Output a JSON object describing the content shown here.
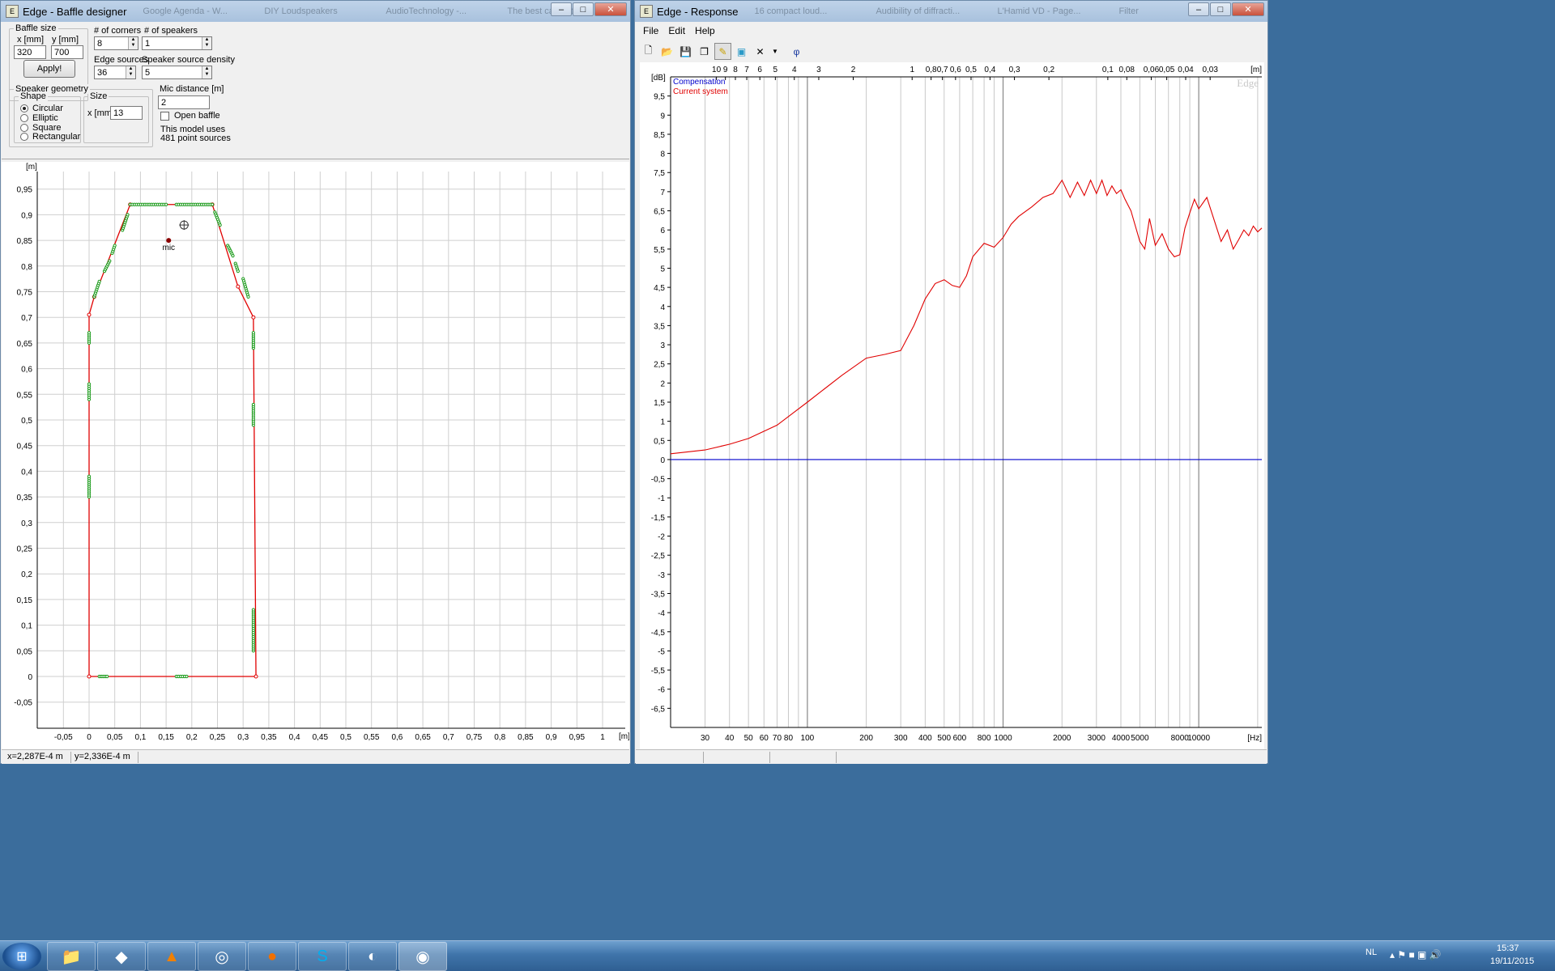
{
  "left_window": {
    "title": "Edge - Baffle designer",
    "baffle_size": {
      "group_label": "Baffle size",
      "x_label": "x [mm]",
      "y_label": "y [mm]",
      "x_value": "320",
      "y_value": "700",
      "apply_label": "Apply!"
    },
    "corners": {
      "label": "# of corners",
      "value": "8"
    },
    "speakers": {
      "label": "# of speakers",
      "value": "1"
    },
    "edge_sources": {
      "label": "Edge sources",
      "value": "36"
    },
    "speaker_density": {
      "label": "Speaker source density",
      "value": "5"
    },
    "speaker_geometry": {
      "group_label": "Speaker geometry",
      "shape_label": "Shape",
      "shapes": [
        "Circular",
        "Elliptic",
        "Square",
        "Rectangular"
      ],
      "selected_shape": "Circular",
      "size_label": "Size",
      "size_x_label": "x [mm]",
      "size_x_value": "13"
    },
    "mic_distance": {
      "label": "Mic distance [m]",
      "value": "2"
    },
    "open_baffle_label": "Open baffle",
    "model_info_line1": "This model uses",
    "model_info_line2": "481 point sources",
    "plot": {
      "unit_label": "[m]",
      "x_ticks": [
        "-0,05",
        "0",
        "0,05",
        "0,1",
        "0,15",
        "0,2",
        "0,25",
        "0,3",
        "0,35",
        "0,4",
        "0,45",
        "0,5",
        "0,55",
        "0,6",
        "0,65",
        "0,7",
        "0,75",
        "0,8",
        "0,85",
        "0,9",
        "0,95",
        "1"
      ],
      "y_ticks": [
        "0,95",
        "0,9",
        "0,85",
        "0,8",
        "0,75",
        "0,7",
        "0,65",
        "0,6",
        "0,55",
        "0,5",
        "0,45",
        "0,4",
        "0,35",
        "0,3",
        "0,25",
        "0,2",
        "0,15",
        "0,1",
        "0,05",
        "0",
        "-0,05"
      ],
      "mic_label": "mic",
      "colors": {
        "outline": "#e00000",
        "sources": "#1a9a1a",
        "mic": "#8b0000"
      }
    },
    "status_x": "x=2,287E-4 m",
    "status_y": "y=2,336E-4 m"
  },
  "right_window": {
    "title": "Edge - Response",
    "bg_tabs": [
      "Google Agenda - W...",
      "DIY Loudspeakers",
      "AudioTechnology -...",
      "The best cabinet s...",
      "16 compact loud...",
      "Audibility of diffracti...",
      "L'Hamid VD - Page...",
      "Filter",
      "Edge"
    ],
    "menu": [
      "File",
      "Edit",
      "Help"
    ],
    "toolbar_icons": [
      "new-file-icon",
      "open-folder-icon",
      "save-icon",
      "copy-icon",
      "pencil-icon",
      "speaker-icon",
      "delete-icon",
      "dropdown-arrow-icon",
      "phase-icon"
    ],
    "phi_symbol": "φ",
    "db_unit": "[dB]",
    "legend": [
      {
        "name": "Compensation",
        "color": "#0000cc"
      },
      {
        "name": "Current system",
        "color": "#e00000"
      }
    ],
    "watermark": "Edge",
    "top_unit": "[m]",
    "top_ticks": [
      "10",
      "9",
      "8",
      "7",
      "6",
      "5",
      "4",
      "3",
      "2",
      "1",
      "0,8",
      "0,7",
      "0,6",
      "0,5",
      "0,4",
      "0,3",
      "0,2",
      "0,1",
      "0,08",
      "0,06",
      "0,05",
      "0,04",
      "0,03"
    ],
    "hz_unit": "[Hz]",
    "hz_ticks": [
      "30",
      "40",
      "50",
      "60",
      "70",
      "80",
      "100",
      "200",
      "300",
      "400",
      "500",
      "600",
      "800",
      "1000",
      "2000",
      "3000",
      "4000",
      "5000",
      "8000",
      "10000"
    ]
  },
  "chart_data": {
    "type": "line",
    "xlabel": "[Hz]",
    "ylabel": "[dB]",
    "x_scale": "log",
    "xlim": [
      20,
      21000
    ],
    "ylim": [
      -7,
      10
    ],
    "y_ticks": [
      "9,5",
      "9",
      "8,5",
      "8",
      "7,5",
      "7",
      "6,5",
      "6",
      "5,5",
      "5",
      "4,5",
      "4",
      "3,5",
      "3",
      "2,5",
      "2",
      "1,5",
      "1",
      "0,5",
      "0",
      "-0,5",
      "-1",
      "-1,5",
      "-2",
      "-2,5",
      "-3",
      "-3,5",
      "-4",
      "-4,5",
      "-5",
      "-5,5",
      "-6",
      "-6,5"
    ],
    "series": [
      {
        "name": "Compensation",
        "color": "#0000cc",
        "x": [
          20,
          21000
        ],
        "y": [
          0,
          0
        ]
      },
      {
        "name": "Current system",
        "color": "#e00000",
        "x": [
          20,
          30,
          40,
          50,
          70,
          100,
          150,
          200,
          250,
          300,
          350,
          400,
          450,
          500,
          550,
          600,
          650,
          700,
          800,
          900,
          1000,
          1100,
          1200,
          1400,
          1600,
          1800,
          2000,
          2200,
          2400,
          2600,
          2800,
          3000,
          3200,
          3400,
          3600,
          3800,
          4000,
          4200,
          4500,
          5000,
          5300,
          5600,
          6000,
          6500,
          7000,
          7500,
          8000,
          8500,
          9000,
          9500,
          10000,
          11000,
          12000,
          13000,
          14000,
          15000,
          16000,
          17000,
          18000,
          19000,
          20000,
          21000
        ],
        "y": [
          0.15,
          0.25,
          0.4,
          0.55,
          0.9,
          1.5,
          2.2,
          2.65,
          2.75,
          2.85,
          3.5,
          4.2,
          4.6,
          4.7,
          4.55,
          4.5,
          4.8,
          5.3,
          5.65,
          5.55,
          5.8,
          6.15,
          6.35,
          6.6,
          6.85,
          6.95,
          7.3,
          6.85,
          7.25,
          6.9,
          7.3,
          6.95,
          7.3,
          6.9,
          7.15,
          6.95,
          7.05,
          6.8,
          6.5,
          5.7,
          5.5,
          6.3,
          5.6,
          5.9,
          5.5,
          5.3,
          5.35,
          6.05,
          6.45,
          6.8,
          6.55,
          6.85,
          6.25,
          5.7,
          6.0,
          5.5,
          5.75,
          6.0,
          5.85,
          6.1,
          5.95,
          6.05
        ]
      }
    ]
  }
}
